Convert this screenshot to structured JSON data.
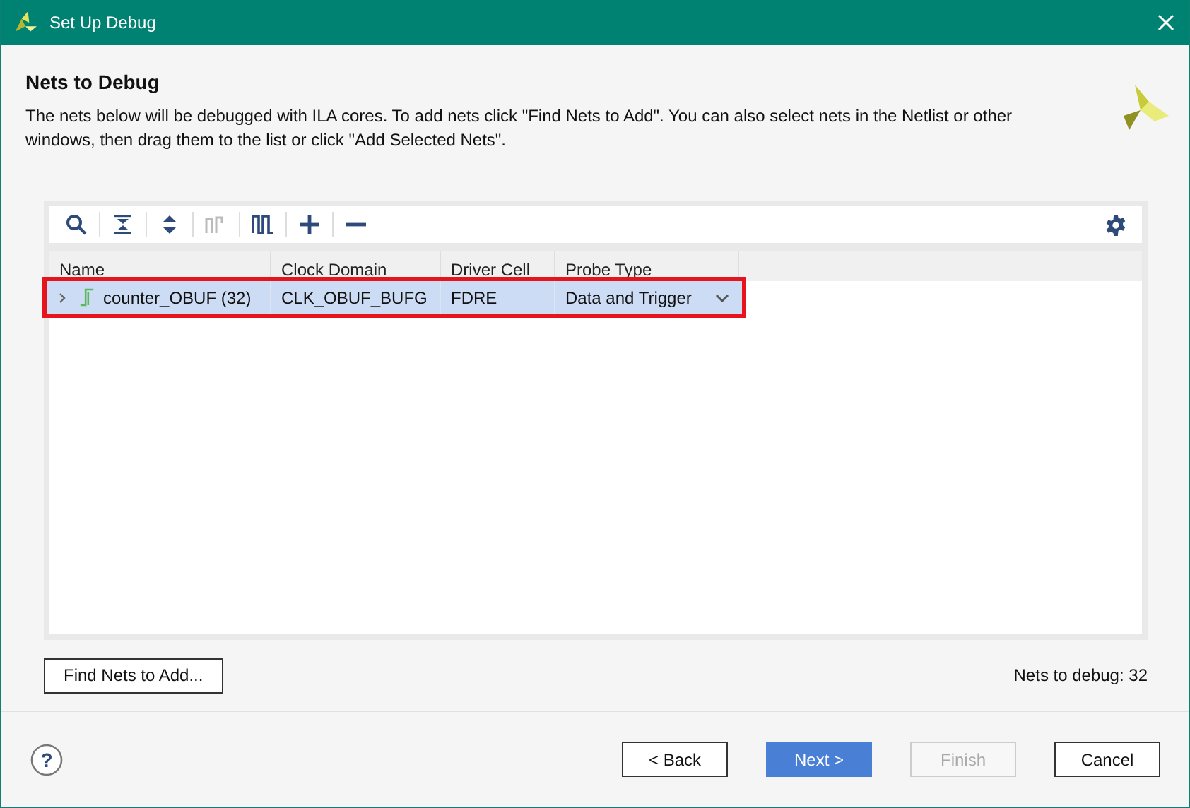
{
  "window": {
    "title": "Set Up Debug"
  },
  "header": {
    "title": "Nets to Debug",
    "description": "The nets below will be debugged with ILA cores. To add nets click \"Find Nets to Add\". You can also select nets in the Netlist or other windows, then drag them to the list or click \"Add Selected Nets\"."
  },
  "toolbar": [
    {
      "kind": "search",
      "disabled": false
    },
    {
      "kind": "collapse",
      "disabled": false
    },
    {
      "kind": "expand",
      "disabled": false
    },
    {
      "kind": "trigger",
      "disabled": true
    },
    {
      "kind": "waveform",
      "disabled": false
    },
    {
      "kind": "add",
      "disabled": false
    },
    {
      "kind": "remove",
      "disabled": false
    }
  ],
  "table": {
    "columns": [
      "Name",
      "Clock Domain",
      "Driver Cell",
      "Probe Type"
    ],
    "rows": [
      {
        "name": "counter_OBUF (32)",
        "clock_domain": "CLK_OBUF_BUFG",
        "driver_cell": "FDRE",
        "probe_type": "Data and Trigger",
        "selected": true,
        "expanded": false,
        "highlighted": true
      }
    ]
  },
  "find_button": "Find Nets to Add...",
  "nets_count": "Nets to debug: 32",
  "help": "?",
  "buttons": [
    {
      "label": "< Back",
      "kind": "default"
    },
    {
      "label": "Next >",
      "kind": "primary"
    },
    {
      "label": "Finish",
      "kind": "disabled"
    },
    {
      "label": "Cancel",
      "kind": "default"
    }
  ]
}
